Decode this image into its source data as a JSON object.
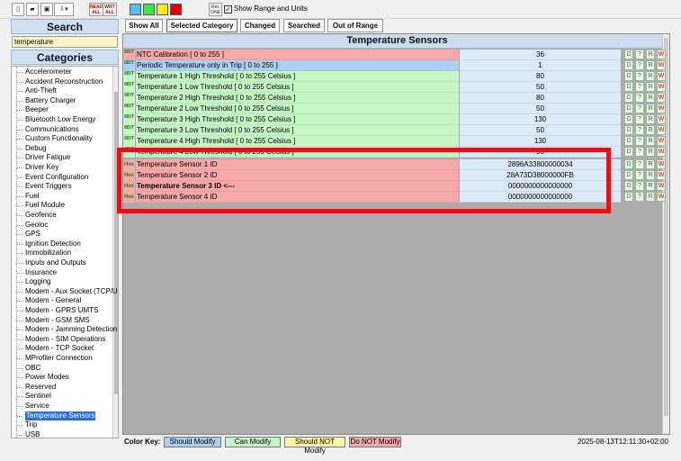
{
  "toolbar": {
    "read_all_label": "READ ALL",
    "write_all_label": "WRT ALL",
    "rec_one_label": "Rec ONE",
    "show_range_label": "Show Range and Units",
    "show_range_checked": true,
    "swatch_colors": [
      "#4ec3f0",
      "#3ee83e",
      "#ffec00",
      "#e00000"
    ]
  },
  "left": {
    "search_title": "Search",
    "search_value": "temperature",
    "categories_title": "Categories",
    "categories": [
      "Accelerometer",
      "Accident Reconstruction",
      "Anti-Theft",
      "Battery Charger",
      "Beeper",
      "Bluetooth Low Energy",
      "Communications",
      "Custom Functionality",
      "Debug",
      "Driver Fatigue",
      "Driver Key",
      "Event Configuration",
      "Event Triggers",
      "Fuel",
      "Fuel Module",
      "Geofence",
      "Geoloc",
      "GPS",
      "Ignition Detection",
      "Immobilization",
      "Inputs and Outputs",
      "Insurance",
      "Logging",
      "Modem - Aux Socket (TCP/UD",
      "Modem - General",
      "Modem - GPRS UMTS",
      "Modem - GSM SMS",
      "Modem - Jamming Detection",
      "Modem - SIM Operations",
      "Modem - TCP Socket",
      "MProfiler Connection",
      "OBC",
      "Power Modes",
      "Reserved",
      "Sentinel",
      "Service",
      "Temperature Sensors",
      "Trip",
      "USB"
    ],
    "selected_category": "Temperature Sensors"
  },
  "tabs": [
    "Show All",
    "Selected Category",
    "Changed",
    "Searched",
    "Out of Range"
  ],
  "active_tab": "Selected Category",
  "table": {
    "title": "Temperature Sensors",
    "actions": [
      "D",
      "?",
      "R",
      "W"
    ],
    "rows": [
      {
        "badge": "8BIT",
        "name": "NTC Calibration  [ 0 to 255 ]",
        "value": "36",
        "color": "red",
        "bold": false
      },
      {
        "badge": "8BIT",
        "name": "Periodic Temperature only in Trip  [ 0 to 255 ]",
        "value": "1",
        "color": "blue",
        "bold": false
      },
      {
        "badge": "8BIT",
        "name": "Temperature 1 High Threshold  [ 0 to 255 Celsius ]",
        "value": "80",
        "color": "green",
        "bold": false
      },
      {
        "badge": "8BIT",
        "name": "Temperature 1 Low Threshold  [ 0 to 255 Celsius ]",
        "value": "50",
        "color": "green",
        "bold": false
      },
      {
        "badge": "8BIT",
        "name": "Temperature 2 High Threshold  [ 0 to 255 Celsius ]",
        "value": "80",
        "color": "green",
        "bold": false
      },
      {
        "badge": "8BIT",
        "name": "Temperature 2 Low Threshold  [ 0 to 255 Celsius ]",
        "value": "50",
        "color": "green",
        "bold": false
      },
      {
        "badge": "8BIT",
        "name": "Temperature 3 High Threshold  [ 0 to 255 Celsius ]",
        "value": "130",
        "color": "green",
        "bold": false
      },
      {
        "badge": "8BIT",
        "name": "Temperature 3 Low Threshold  [ 0 to 255 Celsius ]",
        "value": "50",
        "color": "green",
        "bold": false
      },
      {
        "badge": "8BIT",
        "name": "Temperature 4 High Threshold  [ 0 to 255 Celsius ]",
        "value": "130",
        "color": "green",
        "bold": false
      },
      {
        "badge": "8BIT",
        "name": "Temperature 4 Low Threshold  [ 0 to 255 Celsius ]",
        "value": "50",
        "color": "green",
        "bold": false
      },
      {
        "badge": "Hex",
        "name": "Temperature Sensor 1 ID",
        "value": "2896A33800000034",
        "color": "red",
        "bold": false
      },
      {
        "badge": "Hex",
        "name": "Temperature Sensor 2 ID",
        "value": "28A73D38000000FB",
        "color": "red",
        "bold": false
      },
      {
        "badge": "Hex",
        "name": "Temperature Sensor 3 ID  <---",
        "value": "0000000000000000",
        "color": "red",
        "bold": true
      },
      {
        "badge": "Hex",
        "name": "Temperature Sensor 4 ID",
        "value": "0000000000000000",
        "color": "red",
        "bold": false
      }
    ]
  },
  "color_key": {
    "label": "Color Key:",
    "items": [
      {
        "label": "Should Modify",
        "color": "#a7d1f5"
      },
      {
        "label": "Can Modify",
        "color": "#c4f7c4"
      },
      {
        "label": "Should NOT Modify",
        "color": "#fff4a8"
      },
      {
        "label": "Do NOT Modify",
        "color": "#f8a8a8"
      }
    ]
  },
  "timestamp": "2025-08-13T12:11:30+02:00"
}
